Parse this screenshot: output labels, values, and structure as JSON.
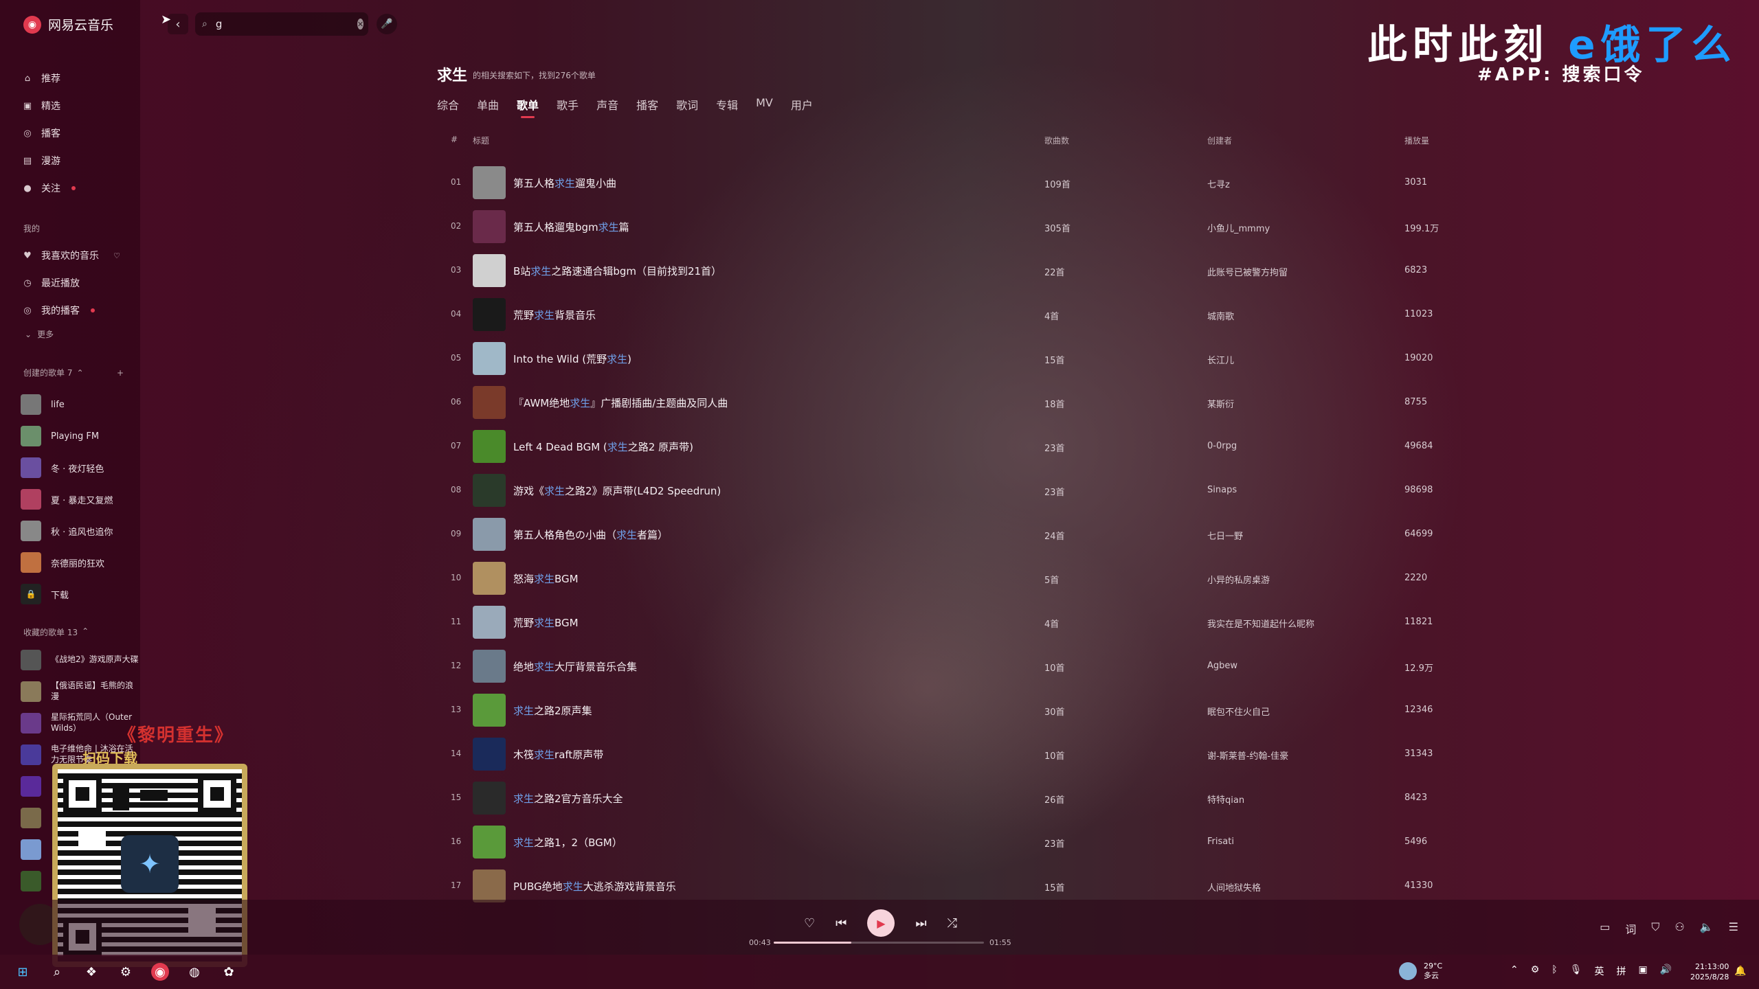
{
  "app": {
    "name": "网易云音乐"
  },
  "search": {
    "value": "g",
    "placeholder": ""
  },
  "sidebar": {
    "nav": [
      {
        "label": "推荐",
        "icon": "home-icon"
      },
      {
        "label": "精选",
        "icon": "grid-icon"
      },
      {
        "label": "播客",
        "icon": "podcast-icon"
      },
      {
        "label": "漫游",
        "icon": "roam-icon"
      },
      {
        "label": "关注",
        "icon": "chat-icon"
      }
    ],
    "mine_label": "我的",
    "mine": [
      {
        "label": "我喜欢的音乐",
        "icon": "heart-icon"
      },
      {
        "label": "最近播放",
        "icon": "clock-icon"
      },
      {
        "label": "我的播客",
        "icon": "podcast-icon"
      }
    ],
    "more_label": "更多",
    "created_label": "创建的歌单 7",
    "created": [
      {
        "label": "life",
        "color": "#777"
      },
      {
        "label": "Playing FM",
        "color": "#6b8f6b"
      },
      {
        "label": "冬 · 夜灯轻色",
        "color": "#6a4fa0"
      },
      {
        "label": "夏 · 暴走又复燃",
        "color": "#b04060"
      },
      {
        "label": "秋 · 追风也追你",
        "color": "#888"
      },
      {
        "label": "奈德丽的狂欢",
        "color": "#c07040"
      },
      {
        "label": "下载",
        "color": "#333"
      }
    ],
    "collected_label": "收藏的歌单 13",
    "collected": [
      {
        "label": "《战地2》游戏原声大碟",
        "color": "#555"
      },
      {
        "label": "【俄语民谣】毛熊的浪漫",
        "color": "#8a7a5a"
      },
      {
        "label": "星际拓荒同人（Outer Wilds）",
        "color": "#6a3a8a"
      },
      {
        "label": "电子维他命 | 沐浴在活力无限节奏",
        "color": "#4a3a9a"
      },
      {
        "label": "",
        "color": "#5a2a9a"
      },
      {
        "label": "",
        "color": "#7a6a4a"
      },
      {
        "label": "",
        "color": "#7a9ad0"
      },
      {
        "label": "",
        "color": "#3a5a2a"
      }
    ]
  },
  "overlay": {
    "caption_top": "《黎明重生》",
    "caption_bottom": "扫码下载"
  },
  "watermark": {
    "line1_a": "此时此刻",
    "line1_b": "e饿了么",
    "line2": "#APP: 搜索口令"
  },
  "header": {
    "title": "求生",
    "subtitle": "的相关搜索如下，找到276个歌单"
  },
  "tabs": [
    "综合",
    "单曲",
    "歌单",
    "歌手",
    "声音",
    "播客",
    "歌词",
    "专辑",
    "MV",
    "用户"
  ],
  "active_tab": "歌单",
  "table": {
    "headers": {
      "idx": "#",
      "title": "标题",
      "count": "歌曲数",
      "creator": "创建者",
      "plays": "播放量"
    },
    "rows": [
      {
        "idx": "01",
        "pre": "第五人格",
        "hl": "求生",
        "post": "遛鬼小曲",
        "count": "109首",
        "creator": "七寻z",
        "plays": "3031",
        "color": "#8a8a8a"
      },
      {
        "idx": "02",
        "pre": "第五人格遛鬼bgm",
        "hl": "求生",
        "post": "篇",
        "count": "305首",
        "creator": "小鱼儿_mmmy",
        "plays": "199.1万",
        "color": "#6a2a4a"
      },
      {
        "idx": "03",
        "pre": "B站",
        "hl": "求生",
        "post": "之路速通合辑bgm（目前找到21首）",
        "count": "22首",
        "creator": "此账号已被警方拘留",
        "plays": "6823",
        "color": "#d0d0d0"
      },
      {
        "idx": "04",
        "pre": "荒野",
        "hl": "求生",
        "post": "背景音乐",
        "count": "4首",
        "creator": "城南歌",
        "plays": "11023",
        "color": "#1a1a1a"
      },
      {
        "idx": "05",
        "pre": "Into the Wild (荒野",
        "hl": "求生",
        "post": ")",
        "count": "15首",
        "creator": "长江儿",
        "plays": "19020",
        "color": "#a0b8c8"
      },
      {
        "idx": "06",
        "pre": "『AWM绝地",
        "hl": "求生",
        "post": "』广播剧插曲/主题曲及同人曲",
        "count": "18首",
        "creator": "某斯衍",
        "plays": "8755",
        "color": "#7a3a2a"
      },
      {
        "idx": "07",
        "pre": "Left 4 Dead BGM (",
        "hl": "求生",
        "post": "之路2 原声带)",
        "count": "23首",
        "creator": "0-0rpg",
        "plays": "49684",
        "color": "#4a8a2a"
      },
      {
        "idx": "08",
        "pre": "游戏《",
        "hl": "求生",
        "post": "之路2》原声带(L4D2 Speedrun)",
        "count": "23首",
        "creator": "Sinaps",
        "plays": "98698",
        "color": "#2a3a2a"
      },
      {
        "idx": "09",
        "pre": "第五人格角色の小曲（",
        "hl": "求生",
        "post": "者篇）",
        "count": "24首",
        "creator": "七日一野",
        "plays": "64699",
        "color": "#8a9aaa"
      },
      {
        "idx": "10",
        "pre": "怒海",
        "hl": "求生",
        "post": "BGM",
        "count": "5首",
        "creator": "小异的私房桌游",
        "plays": "2220",
        "color": "#b09060"
      },
      {
        "idx": "11",
        "pre": "荒野",
        "hl": "求生",
        "post": "BGM",
        "count": "4首",
        "creator": "我实在是不知道起什么昵称",
        "plays": "11821",
        "color": "#9aaaba"
      },
      {
        "idx": "12",
        "pre": "绝地",
        "hl": "求生",
        "post": "大厅背景音乐合集",
        "count": "10首",
        "creator": "Agbew",
        "plays": "12.9万",
        "color": "#6a7a8a"
      },
      {
        "idx": "13",
        "pre": "",
        "hl": "求生",
        "post": "之路2原声集",
        "count": "30首",
        "creator": "眠包不住火自己",
        "plays": "12346",
        "color": "#5a9a3a"
      },
      {
        "idx": "14",
        "pre": "木筏",
        "hl": "求生",
        "post": "raft原声带",
        "count": "10首",
        "creator": "谢-斯莱普-约翰-佳豪",
        "plays": "31343",
        "color": "#1a2a5a"
      },
      {
        "idx": "15",
        "pre": "",
        "hl": "求生",
        "post": "之路2官方音乐大全",
        "count": "26首",
        "creator": "特特qian",
        "plays": "8423",
        "color": "#2a2a2a"
      },
      {
        "idx": "16",
        "pre": "",
        "hl": "求生",
        "post": "之路1，2（BGM）",
        "count": "23首",
        "creator": "Frisati",
        "plays": "5496",
        "color": "#5a9a3a"
      },
      {
        "idx": "17",
        "pre": "PUBG绝地",
        "hl": "求生",
        "post": "大逃杀游戏背景音乐",
        "count": "15首",
        "creator": "人间地狱失格",
        "plays": "41330",
        "color": "#8a6a4a"
      }
    ]
  },
  "player": {
    "time_elapsed": "00:43",
    "time_total": "01:55",
    "progress": 0.37
  },
  "taskbar": {
    "temp": "29°C",
    "weather": "多云",
    "time": "21:13:00",
    "date": "2025/8/28",
    "ime1": "英",
    "ime2": "拼"
  }
}
